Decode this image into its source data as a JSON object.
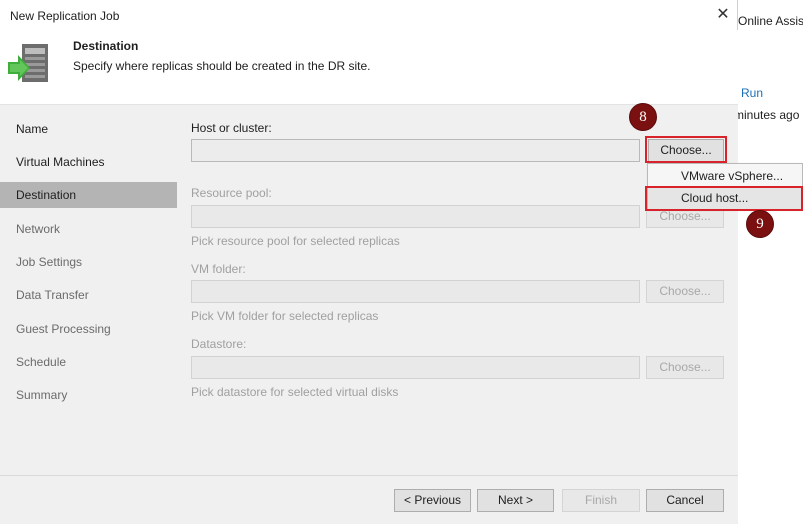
{
  "window": {
    "title": "New Replication Job",
    "close_symbol": "✕"
  },
  "background_app": {
    "online_assist": "Online Assist",
    "run_link": "Run",
    "minutes_ago": "minutes ago"
  },
  "header": {
    "step_title": "Destination",
    "step_description": "Specify where replicas should be created in the DR site.",
    "icon": "replication-destination-icon"
  },
  "sidebar": {
    "items": [
      {
        "label": "Name",
        "state": "normal"
      },
      {
        "label": "Virtual Machines",
        "state": "normal"
      },
      {
        "label": "Destination",
        "state": "active"
      },
      {
        "label": "Network",
        "state": "dim"
      },
      {
        "label": "Job Settings",
        "state": "dim"
      },
      {
        "label": "Data Transfer",
        "state": "dim"
      },
      {
        "label": "Guest Processing",
        "state": "dim"
      },
      {
        "label": "Schedule",
        "state": "dim"
      },
      {
        "label": "Summary",
        "state": "dim"
      }
    ]
  },
  "form": {
    "host": {
      "label": "Host or cluster:",
      "value": "",
      "button": "Choose..."
    },
    "resource_pool": {
      "label": "Resource pool:",
      "value": "",
      "button": "Choose...",
      "hint": "Pick resource pool  for selected replicas"
    },
    "vm_folder": {
      "label": "VM folder:",
      "value": "",
      "button": "Choose...",
      "hint": "Pick VM folder  for selected replicas"
    },
    "datastore": {
      "label": "Datastore:",
      "value": "",
      "button": "Choose...",
      "hint": "Pick datastore  for selected virtual disks"
    }
  },
  "choose_menu": {
    "items": [
      "VMware vSphere...",
      "Cloud host..."
    ]
  },
  "footer": {
    "previous": "< Previous",
    "next": "Next >",
    "finish": "Finish",
    "cancel": "Cancel"
  },
  "annotations": {
    "step_8": "8",
    "step_9": "9",
    "highlight_color": "#d8232a",
    "badge_color": "#7a1010"
  }
}
